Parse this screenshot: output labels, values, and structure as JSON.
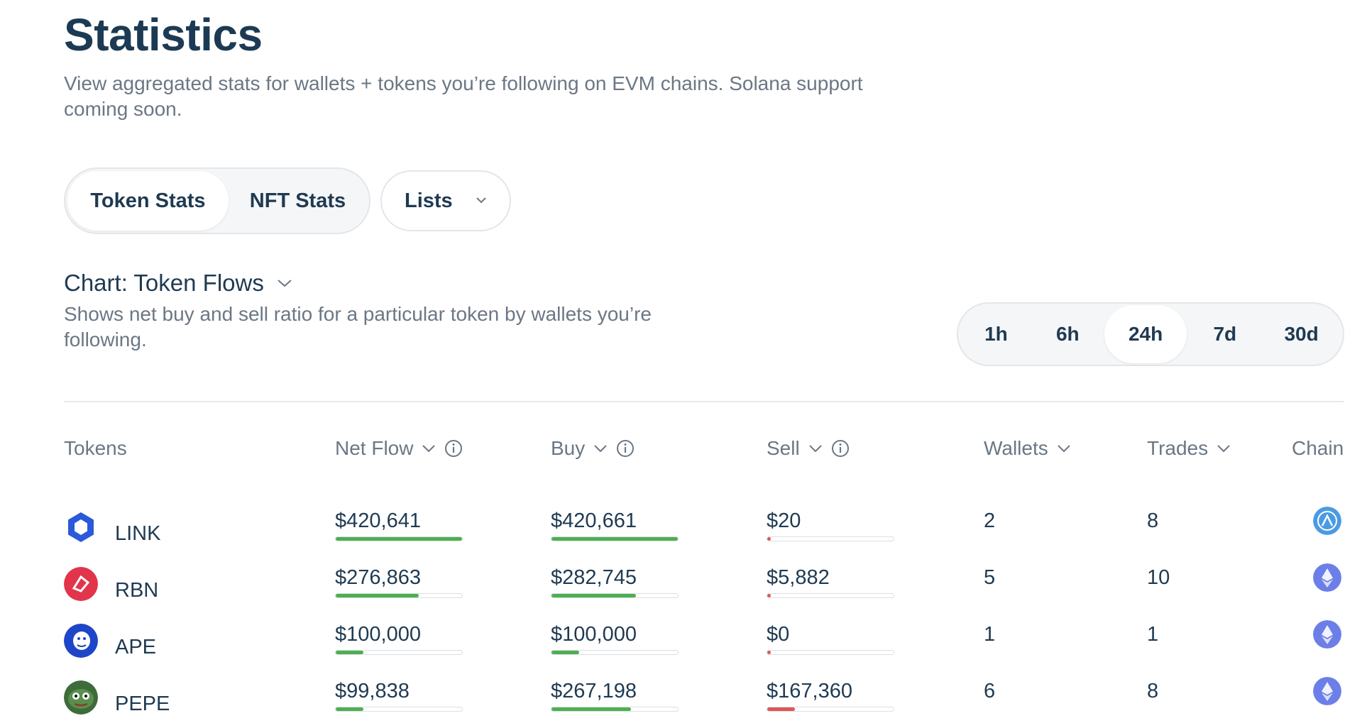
{
  "header": {
    "title": "Statistics",
    "subtitle": "View aggregated stats for wallets + tokens you’re following on EVM chains. Solana support coming soon."
  },
  "tabs": {
    "token_stats": "Token Stats",
    "nft_stats": "NFT Stats",
    "lists": "Lists"
  },
  "chart": {
    "title": "Chart: Token Flows",
    "description": "Shows net buy and sell ratio for a particular token by wallets you’re following."
  },
  "periods": [
    "1h",
    "6h",
    "24h",
    "7d",
    "30d"
  ],
  "active_period": "24h",
  "table": {
    "headers": {
      "tokens": "Tokens",
      "net_flow": "Net Flow",
      "buy": "Buy",
      "sell": "Sell",
      "wallets": "Wallets",
      "trades": "Trades",
      "chain": "Chain"
    },
    "rows": [
      {
        "token": "LINK",
        "net_flow": "$420,641",
        "buy": "$420,661",
        "sell": "$20",
        "wallets": "2",
        "trades": "8",
        "net_fill": 1.0,
        "buy_fill": 1.0,
        "sell_fill": 0.01,
        "chain": "arbitrum"
      },
      {
        "token": "RBN",
        "net_flow": "$276,863",
        "buy": "$282,745",
        "sell": "$5,882",
        "wallets": "5",
        "trades": "10",
        "net_fill": 0.66,
        "buy_fill": 0.67,
        "sell_fill": 0.01,
        "chain": "ethereum"
      },
      {
        "token": "APE",
        "net_flow": "$100,000",
        "buy": "$100,000",
        "sell": "$0",
        "wallets": "1",
        "trades": "1",
        "net_fill": 0.22,
        "buy_fill": 0.22,
        "sell_fill": 0.01,
        "chain": "ethereum"
      },
      {
        "token": "PEPE",
        "net_flow": "$99,838",
        "buy": "$267,198",
        "sell": "$167,360",
        "wallets": "6",
        "trades": "8",
        "net_fill": 0.22,
        "buy_fill": 0.63,
        "sell_fill": 0.22,
        "chain": "ethereum"
      }
    ]
  },
  "colors": {
    "positive": "#4caf50",
    "negative": "#e05555",
    "link_blue": "#2a5ada",
    "rbn_red": "#e2354b",
    "ape_blue": "#1f46c8",
    "eth_purple": "#6c7fe8",
    "arb_blue": "#4a9be3"
  }
}
